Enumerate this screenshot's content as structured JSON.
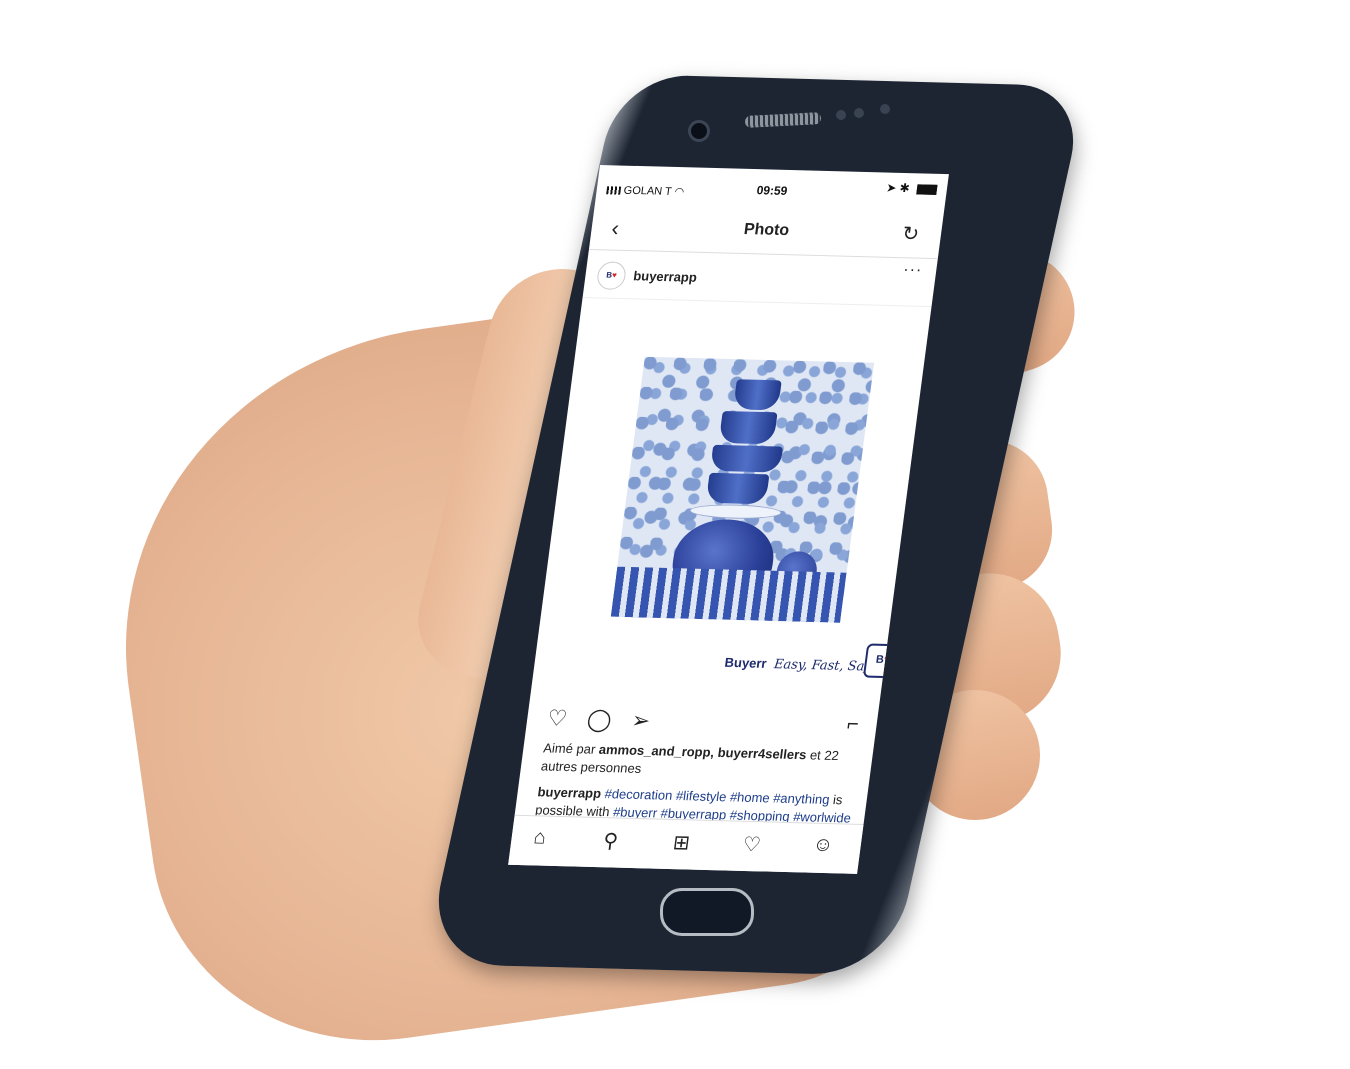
{
  "status_bar": {
    "carrier": "GOLAN T",
    "time": "09:59",
    "right_icons": "➤ ✱"
  },
  "nav": {
    "title": "Photo"
  },
  "post": {
    "username": "buyerrapp",
    "avatar_text": "B",
    "brand_name": "Buyerr",
    "brand_tagline": "Easy, Fast, Safe",
    "brand_logo_text": "B",
    "likes_prefix": "Aimé par",
    "likes_users": "ammos_and_ropp, buyerr4sellers",
    "likes_suffix": "et 22 autres personnes",
    "caption_user": "buyerrapp",
    "caption_tags_1": "#decoration #lifestyle #home #anything",
    "caption_text_1": "is possible with",
    "caption_tags_2": "#buyerr #buyerrapp #shopping #worlwide"
  },
  "icons": {
    "back": "back-icon",
    "refresh": "refresh-icon",
    "more": "more-icon",
    "like": "heart-icon",
    "comment": "comment-icon",
    "share": "send-icon",
    "bookmark": "bookmark-icon",
    "tab_home": "home-icon",
    "tab_search": "search-icon",
    "tab_add": "add-icon",
    "tab_activity": "heart-icon",
    "tab_profile": "profile-icon"
  },
  "colors": {
    "brand_navy": "#1d2a6b",
    "brand_red": "#d8232a",
    "hashtag": "#1d3d8a"
  }
}
